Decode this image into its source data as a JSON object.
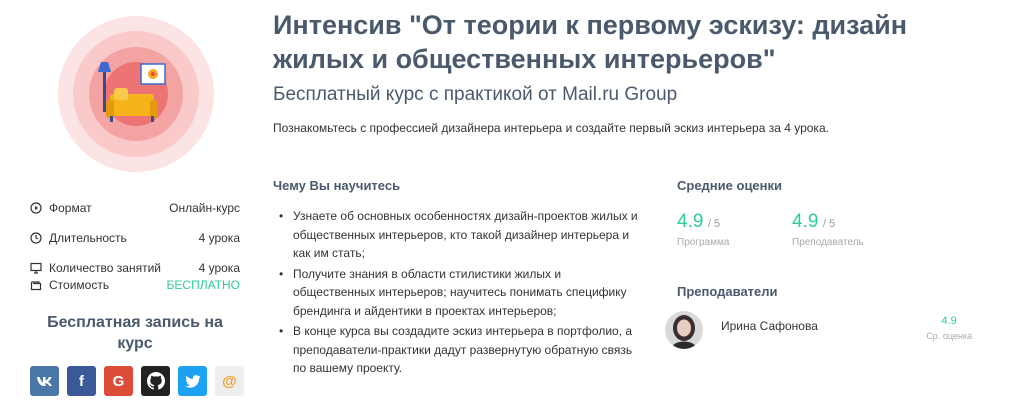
{
  "course": {
    "title": "Интенсив \"От теории к первому эскизу: дизайн жилых и общественных интерьеров\"",
    "subtitle": "Бесплатный курс с практикой от Mail.ru Group",
    "description": "Познакомьтесь с профессией дизайнера интерьера и создайте первый эскиз интерьера за 4 урока."
  },
  "info": [
    {
      "icon": "play-circle-icon",
      "label": "Формат",
      "value": "Онлайн-курс"
    },
    {
      "icon": "clock-icon",
      "label": "Длительность",
      "value": "4 урока"
    },
    {
      "icon": "monitor-icon",
      "label": "Количество занятий",
      "value": "4 урока"
    },
    {
      "icon": "wallet-icon",
      "label": "Стоимость",
      "value": "БЕСПЛАТНО"
    }
  ],
  "signup": {
    "title": "Бесплатная запись на курс",
    "socials": [
      {
        "name": "vk",
        "glyph": "vk",
        "color": "#4a76a8"
      },
      {
        "name": "facebook",
        "glyph": "f",
        "color": "#3b5998"
      },
      {
        "name": "google",
        "glyph": "G",
        "color": "#dd4b39"
      },
      {
        "name": "github",
        "glyph": "",
        "color": "#222222"
      },
      {
        "name": "twitter",
        "glyph": "",
        "color": "#1da1f2"
      },
      {
        "name": "mailru",
        "glyph": "@",
        "color": "#eeeeee",
        "fg": "#f79c1e"
      }
    ]
  },
  "learn": {
    "title": "Чему Вы научитесь",
    "items": [
      "Узнаете об основных особенностях дизайн-проектов жилых и общественных интерьеров, кто такой дизайнер интерьера и как им стать;",
      "Получите знания в области стилистики жилых и общественных интерьеров; научитесь понимать специфику брендинга и айдентики в проектах интерьеров;",
      "В конце курса вы создадите эскиз интерьера в портфолио, а преподаватели-практики дадут развернутую обратную связь по вашему проекту."
    ]
  },
  "ratings": {
    "title": "Средние оценки",
    "of": "/ 5",
    "items": [
      {
        "value": "4.9",
        "caption": "Программа"
      },
      {
        "value": "4.9",
        "caption": "Преподаватель"
      }
    ]
  },
  "teachers": {
    "title": "Преподаватели",
    "items": [
      {
        "name": "Ирина Сафонова",
        "score": "4.9",
        "score_caption": "Ср. оценка"
      }
    ]
  }
}
